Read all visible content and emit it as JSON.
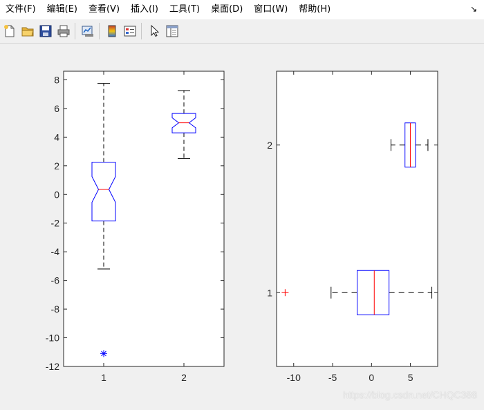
{
  "menu": {
    "items": [
      "文件(F)",
      "编辑(E)",
      "查看(V)",
      "插入(I)",
      "工具(T)",
      "桌面(D)",
      "窗口(W)",
      "帮助(H)"
    ],
    "corner_icon": "dock-arrow-icon"
  },
  "toolbar": {
    "buttons": [
      "new-file-icon",
      "open-folder-icon",
      "save-icon",
      "print-icon",
      "link-plot-icon",
      "colorbar-icon",
      "legend-icon",
      "pointer-icon",
      "property-editor-icon"
    ]
  },
  "watermark": "https://blog.csdn.net/CHQC388",
  "chart_data": [
    {
      "type": "boxplot",
      "orientation": "vertical",
      "notched": true,
      "categories": [
        "1",
        "2"
      ],
      "x_ticks": [
        "1",
        "2"
      ],
      "y_ticks": [
        "-12",
        "-10",
        "-8",
        "-6",
        "-4",
        "-2",
        "0",
        "2",
        "4",
        "6",
        "8"
      ],
      "ylim": [
        -12,
        8.6
      ],
      "boxes": [
        {
          "label": "1",
          "min": -5.2,
          "q1": -1.85,
          "median": 0.35,
          "q3": 2.25,
          "max": 7.75,
          "notch_low": -0.55,
          "notch_high": 1.25,
          "outliers": [
            -11.1
          ],
          "outlier_marker": "*"
        },
        {
          "label": "2",
          "min": 2.5,
          "q1": 4.3,
          "median": 5.0,
          "q3": 5.65,
          "max": 7.25,
          "notch_low": 4.65,
          "notch_high": 5.35,
          "outliers": []
        }
      ],
      "colors": {
        "box": "#0000ff",
        "median": "#ff0000",
        "whisker": "#000000",
        "outlier": "#0000ff"
      }
    },
    {
      "type": "boxplot",
      "orientation": "horizontal",
      "notched": false,
      "categories": [
        "1",
        "2"
      ],
      "x_ticks": [
        "-10",
        "-5",
        "0",
        "5"
      ],
      "y_ticks": [
        "1",
        "2"
      ],
      "xlim": [
        -12.2,
        8.5
      ],
      "ylim": [
        0.5,
        2.5
      ],
      "boxes": [
        {
          "label": "1",
          "min": -5.2,
          "q1": -1.85,
          "median": 0.35,
          "q3": 2.25,
          "max": 7.75,
          "outliers": [
            -11.1
          ],
          "outlier_marker": "+"
        },
        {
          "label": "2",
          "min": 2.5,
          "q1": 4.3,
          "median": 5.0,
          "q3": 5.65,
          "max": 7.25,
          "outliers": []
        }
      ],
      "colors": {
        "box": "#0000ff",
        "median": "#ff0000",
        "whisker": "#000000",
        "outlier": "#ff0000"
      }
    }
  ]
}
